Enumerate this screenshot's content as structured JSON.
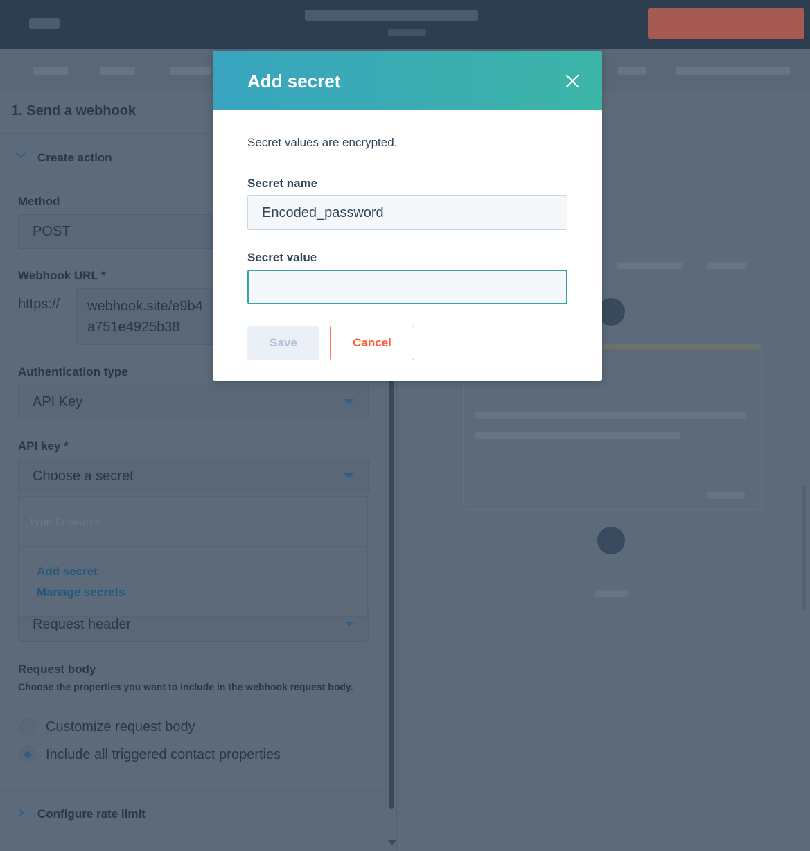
{
  "modal": {
    "title": "Add secret",
    "description": "Secret values are encrypted.",
    "secret_name_label": "Secret name",
    "secret_name_value": "Encoded_password",
    "secret_value_label": "Secret value",
    "secret_value_value": "",
    "save_label": "Save",
    "cancel_label": "Cancel",
    "close_icon": "close-icon"
  },
  "background": {
    "panel_title": "1. Send a webhook",
    "create_action_label": "Create action",
    "method_label": "Method",
    "method_value": "POST",
    "webhook_url_label": "Webhook URL *",
    "url_prefix": "https://",
    "url_line1": "webhook.site/e9b4",
    "url_line2": "a751e4925b38",
    "auth_type_label": "Authentication type",
    "auth_type_value": "API Key",
    "api_key_label": "API key *",
    "api_key_placeholder": "Choose a secret",
    "search_placeholder": "Type to search",
    "add_secret_link": "Add secret",
    "manage_secrets_link": "Manage secrets",
    "api_key_location_value": "Request header",
    "request_body_label": "Request body",
    "request_body_help": "Choose the properties you want to include in the webhook request body.",
    "radio_options": [
      {
        "label": "Customize request body",
        "checked": false
      },
      {
        "label": "Include all triggered contact properties",
        "checked": true
      }
    ],
    "rate_limit_label": "Configure rate limit"
  },
  "colors": {
    "header_gradient_start": "#39a4bf",
    "header_gradient_end": "#3cb5a7",
    "cancel_accent": "#ff5c35",
    "overlay": "#5d6a7a"
  }
}
